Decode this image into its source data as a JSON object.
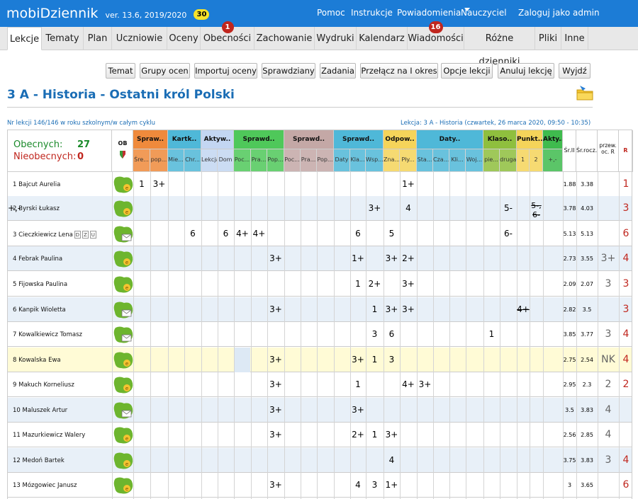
{
  "app": {
    "brand_a": "mobi",
    "brand_b": "Dziennik",
    "version": "ver. 13.6, 2019/2020",
    "counter": "30"
  },
  "toplinks": [
    "Pomoc",
    "Instrukcje",
    "Powiadomienia",
    "Nauczyciel",
    "Zaloguj jako admin"
  ],
  "tabs": [
    {
      "label": "Lekcje",
      "active": true
    },
    {
      "label": "Tematy"
    },
    {
      "label": "Plan"
    },
    {
      "label": "Uczniowie"
    },
    {
      "label": "Oceny"
    },
    {
      "label": "Obecności",
      "badge": "1"
    },
    {
      "label": "Zachowanie"
    },
    {
      "label": "Wydruki"
    },
    {
      "label": "Kalendarz"
    },
    {
      "label": "Wiadomości",
      "badge": "16"
    },
    {
      "label": "Różne dzienniki"
    },
    {
      "label": "Pliki"
    },
    {
      "label": "Inne"
    }
  ],
  "actions": [
    "Temat",
    "Grupy ocen",
    "Importuj oceny",
    "Sprawdziany",
    "Zadania",
    "Przełącz na I okres",
    "Opcje lekcji",
    "Anuluj lekcję",
    "Wyjdź"
  ],
  "title": "3 A - Historia - Ostatni król Polski",
  "info_left": "Nr lekcji 146/146 w roku szkolnym/w całym cyklu",
  "info_right": "Lekcja: 3 A - Historia (czwartek, 26 marca 2020, 09:50 - 10:35)",
  "presence": {
    "present_label": "Obecnych:",
    "present": "27",
    "absent_label": "Nieobecnych:",
    "absent": "0"
  },
  "ob_label": "OB",
  "groups": [
    {
      "label": "Spraw..",
      "color": "#ef8a3c",
      "subs": [
        "Śre...",
        "pop..."
      ]
    },
    {
      "label": "Kartk..",
      "color": "#4fb8d8",
      "subs": [
        "Mie...",
        "Chr..."
      ]
    },
    {
      "label": "Aktyw..",
      "color": "#c3d6f2",
      "subs": [
        "Lekcja",
        "Dom"
      ]
    },
    {
      "label": "Sprawd..",
      "color": "#4fc85a",
      "subs": [
        "Poc...",
        "Pra...",
        "Pop..."
      ]
    },
    {
      "label": "Sprawd..",
      "color": "#c4a8a6",
      "subs": [
        "Poc...",
        "Pra...",
        "Pop..."
      ]
    },
    {
      "label": "Sprawd..",
      "color": "#4fb8d8",
      "subs": [
        "Daty",
        "Kla...",
        "Wsp..."
      ]
    },
    {
      "label": "Odpow..",
      "color": "#f5d45a",
      "subs": [
        "Zna...",
        "Pły..."
      ]
    },
    {
      "label": "Daty..",
      "color": "#4fb8d8",
      "subs": [
        "Sta...",
        "Cza...",
        "Kli...",
        "Woj..."
      ]
    },
    {
      "label": "Klaso..",
      "color": "#8fbf3e",
      "subs": [
        "pie...",
        "druga"
      ]
    },
    {
      "label": "Punkt..",
      "color": "#f5d45a",
      "subs": [
        "1",
        "2"
      ]
    },
    {
      "label": "Akty..",
      "color": "#3fbb4e",
      "subs": [
        "+,-"
      ]
    }
  ],
  "stat_headers": [
    "Śr.II",
    "Śr.rocz.",
    "przew. oc. R",
    "R"
  ],
  "students": [
    {
      "name": "1 Bajcut Aurelia",
      "sr2": "1.88",
      "srr": "3.38",
      "przew": "",
      "r": "1"
    },
    {
      "name": "2 Byrski Łukasz",
      "sr2": "3.78",
      "srr": "4.03",
      "przew": "",
      "r": "3"
    },
    {
      "name": "3 Cieczkiewicz Lena",
      "sr2": "5.13",
      "srr": "5.13",
      "przew": "",
      "r": "6",
      "badges": [
        "D",
        "Z",
        "U"
      ]
    },
    {
      "name": "4 Febrak Paulina",
      "sr2": "2.73",
      "srr": "3.55",
      "przew": "3+",
      "r": "4"
    },
    {
      "name": "5 Fijowska Paulina",
      "sr2": "2.09",
      "srr": "2.07",
      "przew": "3",
      "r": "3"
    },
    {
      "name": "6 Kanpik Wioletta",
      "sr2": "2.82",
      "srr": "3.5",
      "przew": "",
      "r": "3"
    },
    {
      "name": "7 Kowalkiewicz Tomasz",
      "sr2": "3.85",
      "srr": "3.77",
      "przew": "3",
      "r": "4"
    },
    {
      "name": "8 Kowalska Ewa",
      "sr2": "2.75",
      "srr": "2.54",
      "przew": "NK",
      "r": "4"
    },
    {
      "name": "9 Makuch Korneliusz",
      "sr2": "2.95",
      "srr": "2.3",
      "przew": "2",
      "r": "2"
    },
    {
      "name": "10 Maluszek Artur",
      "sr2": "3.5",
      "srr": "3.83",
      "przew": "4",
      "r": ""
    },
    {
      "name": "11 Mazurkiewicz Walery",
      "sr2": "2.56",
      "srr": "2.85",
      "przew": "4",
      "r": ""
    },
    {
      "name": "12 Medoń Bartek",
      "sr2": "3.75",
      "srr": "3.83",
      "przew": "3",
      "r": "4"
    },
    {
      "name": "13 Mózgowiec Janusz",
      "sr2": "3",
      "srr": "3.65",
      "przew": "",
      "r": "6"
    }
  ],
  "grades": [
    [
      [
        "0",
        "1"
      ],
      [
        "1",
        "3+"
      ],
      [
        "16",
        "1+"
      ]
    ],
    [
      [
        "14",
        "3+"
      ],
      [
        "16",
        "4"
      ],
      [
        "22",
        "5-"
      ],
      [
        "24",
        "5-, 6-",
        "s"
      ],
      [
        "28",
        "+,-"
      ]
    ],
    [
      [
        "3",
        "6"
      ],
      [
        "5",
        "6"
      ],
      [
        "6",
        "4+"
      ],
      [
        "7",
        "4+"
      ],
      [
        "13",
        "6"
      ],
      [
        "15",
        "5"
      ],
      [
        "22",
        "6-"
      ]
    ],
    [
      [
        "8",
        "3+"
      ],
      [
        "13",
        "1+"
      ],
      [
        "15",
        "3+"
      ],
      [
        "16",
        "2+"
      ]
    ],
    [
      [
        "13",
        "1"
      ],
      [
        "14",
        "2+"
      ],
      [
        "16",
        "3+"
      ]
    ],
    [
      [
        "8",
        "3+"
      ],
      [
        "14",
        "1"
      ],
      [
        "15",
        "3+"
      ],
      [
        "16",
        "3+"
      ],
      [
        "23",
        "4+",
        "s"
      ]
    ],
    [
      [
        "14",
        "3"
      ],
      [
        "15",
        "6"
      ],
      [
        "21",
        "1"
      ]
    ],
    [
      [
        "8",
        "3+"
      ],
      [
        "13",
        "3+"
      ],
      [
        "14",
        "1"
      ],
      [
        "15",
        "3"
      ]
    ],
    [
      [
        "8",
        "3+"
      ],
      [
        "13",
        "1"
      ],
      [
        "16",
        "4+"
      ],
      [
        "17",
        "3+"
      ]
    ],
    [
      [
        "8",
        "3+"
      ],
      [
        "13",
        "3+"
      ]
    ],
    [
      [
        "8",
        "3+"
      ],
      [
        "13",
        "2+"
      ],
      [
        "14",
        "1"
      ],
      [
        "15",
        "3+"
      ]
    ],
    [
      [
        "15",
        "4"
      ]
    ],
    [
      [
        "8",
        "3+"
      ],
      [
        "13",
        "4"
      ],
      [
        "14",
        "3"
      ],
      [
        "15",
        "1+"
      ]
    ]
  ]
}
